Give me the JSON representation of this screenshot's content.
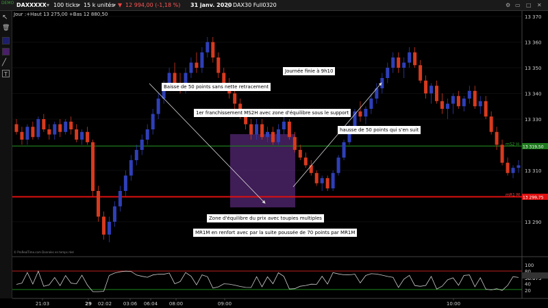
{
  "topbar": {
    "symbol": "DAXXXXX",
    "ticks": "100 ticks",
    "units": "15 k unités",
    "price_change": "12 994,00 (-1,18 %)",
    "date": "31 janv. 2020",
    "instrument": "DAX30 Full0320",
    "badge": "DEMO"
  },
  "subline": "Jour :+Haut 13 275,00 +Bas 12 880,50",
  "watermark": "© ProRealTime.com Données en temps réel",
  "colors": {
    "up": "#2e3fb8",
    "down": "#d83a1e",
    "ms2h": "#1e7a1e",
    "mr1m": "#e01010",
    "zone": "#5a2a7a",
    "osc_line": "#cfcfcf"
  },
  "levels": {
    "ms2h": {
      "label": "mS2 H",
      "value": "13 319,50",
      "price": 13319.5
    },
    "mr1m": {
      "label": "mR1 M",
      "value": "13 299,75",
      "price": 13299.75
    }
  },
  "chart_data": {
    "type": "candlestick",
    "y_axis": {
      "ticks": [
        13370,
        13360,
        13350,
        13340,
        13330,
        13310,
        13290
      ],
      "labels": [
        "13 370",
        "13 360",
        "13 350",
        "13 340",
        "13 330",
        "13 310",
        "13 290"
      ],
      "ylim": [
        13280,
        13372
      ]
    },
    "x_axis": {
      "labels": [
        "21:03",
        "29",
        "02:02",
        "03:06",
        "06:04",
        "08:00",
        "09:00",
        "10:00"
      ]
    },
    "series": [
      {
        "segment": "night-decline",
        "values": [
          [
            13328,
            13330,
            13324,
            13325
          ],
          [
            13325,
            13327,
            13320,
            13322
          ],
          [
            13322,
            13328,
            13320,
            13327
          ],
          [
            13327,
            13329,
            13322,
            13323
          ],
          [
            13323,
            13331,
            13322,
            13330
          ],
          [
            13330,
            13332,
            13325,
            13326
          ],
          [
            13326,
            13328,
            13322,
            13324
          ],
          [
            13324,
            13329,
            13322,
            13328
          ],
          [
            13328,
            13330,
            13323,
            13325
          ],
          [
            13325,
            13330,
            13324,
            13329
          ],
          [
            13329,
            13331,
            13324,
            13326
          ],
          [
            13326,
            13328,
            13321,
            13322
          ],
          [
            13322,
            13326,
            13320,
            13325
          ],
          [
            13325,
            13327,
            13320,
            13321
          ],
          [
            13321,
            13322,
            13300,
            13302
          ],
          [
            13302,
            13304,
            13290,
            13292
          ],
          [
            13292,
            13294,
            13283,
            13285
          ]
        ]
      },
      {
        "segment": "rally",
        "values": [
          [
            13285,
            13292,
            13282,
            13290
          ],
          [
            13290,
            13298,
            13288,
            13296
          ],
          [
            13296,
            13304,
            13294,
            13302
          ],
          [
            13302,
            13310,
            13300,
            13308
          ],
          [
            13308,
            13316,
            13306,
            13314
          ],
          [
            13314,
            13320,
            13312,
            13318
          ],
          [
            13318,
            13324,
            13316,
            13322
          ],
          [
            13322,
            13328,
            13320,
            13326
          ],
          [
            13326,
            13334,
            13324,
            13332
          ],
          [
            13332,
            13340,
            13330,
            13338
          ],
          [
            13338,
            13345,
            13336,
            13343
          ],
          [
            13343,
            13350,
            13341,
            13348
          ],
          [
            13348,
            13352,
            13342,
            13344
          ],
          [
            13344,
            13348,
            13340,
            13342
          ],
          [
            13342,
            13350,
            13340,
            13348
          ],
          [
            13348,
            13354,
            13346,
            13352
          ],
          [
            13352,
            13356,
            13348,
            13350
          ],
          [
            13350,
            13358,
            13348,
            13356
          ],
          [
            13356,
            13362,
            13354,
            13360
          ],
          [
            13360,
            13362,
            13352,
            13354
          ]
        ]
      },
      {
        "segment": "decline-50-points",
        "values": [
          [
            13354,
            13356,
            13346,
            13348
          ],
          [
            13348,
            13350,
            13342,
            13344
          ],
          [
            13344,
            13346,
            13338,
            13340
          ],
          [
            13340,
            13342,
            13334,
            13336
          ],
          [
            13336,
            13338,
            13330,
            13332
          ],
          [
            13332,
            13334,
            13326,
            13328
          ],
          [
            13328,
            13330,
            13322,
            13324
          ],
          [
            13324,
            13330,
            13322,
            13328
          ],
          [
            13328,
            13330,
            13322,
            13323
          ],
          [
            13323,
            13327,
            13321,
            13325
          ],
          [
            13325,
            13327,
            13320,
            13321
          ],
          [
            13321,
            13328,
            13320,
            13326
          ],
          [
            13326,
            13331,
            13324,
            13329
          ],
          [
            13329,
            13330,
            13322,
            13323
          ],
          [
            13323,
            13325,
            13317,
            13318
          ],
          [
            13318,
            13320,
            13314,
            13315
          ],
          [
            13315,
            13317,
            13311,
            13312
          ],
          [
            13312,
            13314,
            13308,
            13309
          ],
          [
            13309,
            13310,
            13304,
            13305
          ],
          [
            13305,
            13308,
            13302,
            13307
          ],
          [
            13307,
            13308,
            13302,
            13303
          ]
        ]
      },
      {
        "segment": "rise-50-points",
        "values": [
          [
            13303,
            13310,
            13302,
            13309
          ],
          [
            13309,
            13316,
            13308,
            13315
          ],
          [
            13315,
            13322,
            13314,
            13321
          ],
          [
            13321,
            13328,
            13320,
            13327
          ],
          [
            13327,
            13334,
            13326,
            13333
          ],
          [
            13333,
            13337,
            13329,
            13331
          ],
          [
            13331,
            13335,
            13328,
            13334
          ],
          [
            13334,
            13340,
            13332,
            13338
          ],
          [
            13338,
            13344,
            13336,
            13342
          ],
          [
            13342,
            13348,
            13340,
            13346
          ],
          [
            13346,
            13352,
            13344,
            13350
          ],
          [
            13350,
            13356,
            13348,
            13354
          ],
          [
            13354,
            13356,
            13348,
            13350
          ],
          [
            13350,
            13354,
            13346,
            13352
          ],
          [
            13352,
            13358,
            13350,
            13356
          ],
          [
            13356,
            13358,
            13350,
            13351
          ]
        ]
      },
      {
        "segment": "afternoon",
        "values": [
          [
            13351,
            13353,
            13344,
            13345
          ],
          [
            13345,
            13347,
            13338,
            13340
          ],
          [
            13340,
            13344,
            13336,
            13343
          ],
          [
            13343,
            13345,
            13336,
            13337
          ],
          [
            13337,
            13340,
            13332,
            13334
          ],
          [
            13334,
            13338,
            13330,
            13336
          ],
          [
            13336,
            13340,
            13332,
            13339
          ],
          [
            13339,
            13341,
            13334,
            13335
          ],
          [
            13335,
            13339,
            13333,
            13338
          ],
          [
            13338,
            13343,
            13336,
            13341
          ],
          [
            13341,
            13343,
            13334,
            13335
          ],
          [
            13335,
            13339,
            13332,
            13337
          ],
          [
            13337,
            13339,
            13330,
            13331
          ],
          [
            13331,
            13333,
            13324,
            13325
          ],
          [
            13325,
            13327,
            13318,
            13320
          ],
          [
            13320,
            13322,
            13312,
            13313
          ],
          [
            13313,
            13315,
            13308,
            13309
          ],
          [
            13309,
            13312,
            13307,
            13311
          ],
          [
            13311,
            13314,
            13309,
            13312
          ]
        ]
      }
    ],
    "oscillator": {
      "ticks": [
        100,
        80,
        58.675,
        40,
        20
      ],
      "labels": [
        "100",
        "80",
        "58.675",
        "40",
        "20"
      ],
      "current": 58.675,
      "overbought": 80,
      "oversold": 20
    }
  },
  "annotations": {
    "a1": "Baisse de 50 points sans nette retracement",
    "a2": "1er franchissement MS2H avec zone d'équilibre sous le support",
    "a3": "Journée finie à 9h10",
    "a4": "hausse de 50 points qui s'en suit",
    "a5": "Zone d'équilibre du prix avec toupies multiples",
    "a6": "MR1M en renfort avec par la suite poussée de 70 points par MR1M"
  }
}
